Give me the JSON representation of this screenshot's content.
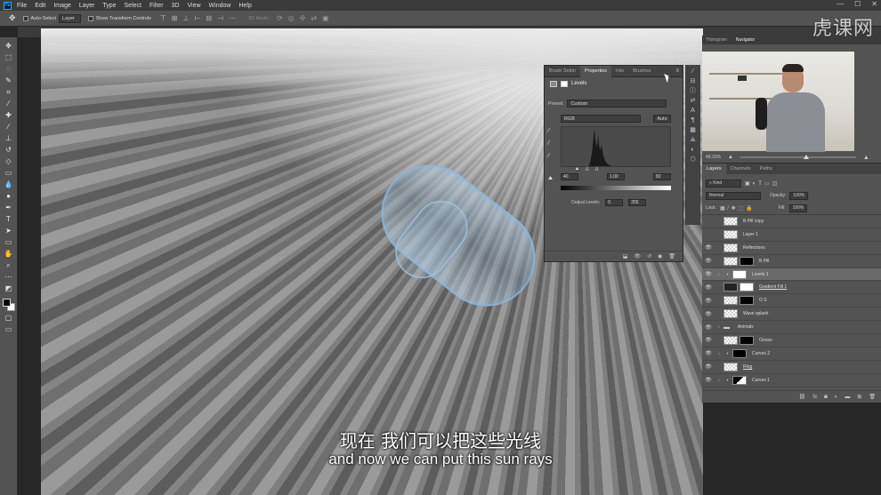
{
  "app": {
    "logo": "Ps"
  },
  "menu": [
    "File",
    "Edit",
    "Image",
    "Layer",
    "Type",
    "Select",
    "Filter",
    "3D",
    "View",
    "Window",
    "Help"
  ],
  "window_controls": {
    "minimize": "—",
    "maximize": "☐",
    "close": "✕"
  },
  "options": {
    "auto_select": "Auto-Select",
    "target": "Layer",
    "show_transform": "Show Transform Controls",
    "mode_3d": "3D Mode:"
  },
  "subtitle": {
    "chinese": "现在 我们可以把这些光线",
    "english": "and now we can put this sun rays"
  },
  "watermark": "虎课网",
  "properties": {
    "tabs": [
      "Brush Settin",
      "Properties",
      "Info",
      "Brushes"
    ],
    "active_tab": "Properties",
    "title": "Levels",
    "preset_label": "Preset:",
    "preset_value": "Custom",
    "channel": "RGB",
    "auto_label": "Auto",
    "input_black": "40",
    "input_mid": "1.00",
    "input_white": "82",
    "output_label": "Output Levels:",
    "output_black": "0",
    "output_white": "255"
  },
  "navigator": {
    "tabs": [
      "Histogram",
      "Navigator"
    ],
    "zoom": "49.31%"
  },
  "layers_panel": {
    "tabs": [
      "Layers",
      "Channels",
      "Paths"
    ],
    "kind": "Kind",
    "blend": "Normal",
    "opacity_label": "Opacity:",
    "opacity": "100%",
    "lock_label": "Lock:",
    "fill_label": "Fill:",
    "fill": "100%",
    "items": [
      {
        "name": "B Pill copy",
        "visible": false
      },
      {
        "name": "Layer 1",
        "visible": false
      },
      {
        "name": "Reflections",
        "visible": true
      },
      {
        "name": "B Pill",
        "visible": true
      },
      {
        "name": "Levels 1",
        "visible": true
      },
      {
        "name": "Gradient Fill 1",
        "visible": true
      },
      {
        "name": "O S",
        "visible": true
      },
      {
        "name": "Wave splash",
        "visible": true
      },
      {
        "name": "Animals",
        "visible": true
      },
      {
        "name": "Ocean",
        "visible": true
      },
      {
        "name": "Curves 2",
        "visible": true
      },
      {
        "name": "Ring",
        "visible": true
      },
      {
        "name": "Curves 1",
        "visible": true
      }
    ]
  }
}
